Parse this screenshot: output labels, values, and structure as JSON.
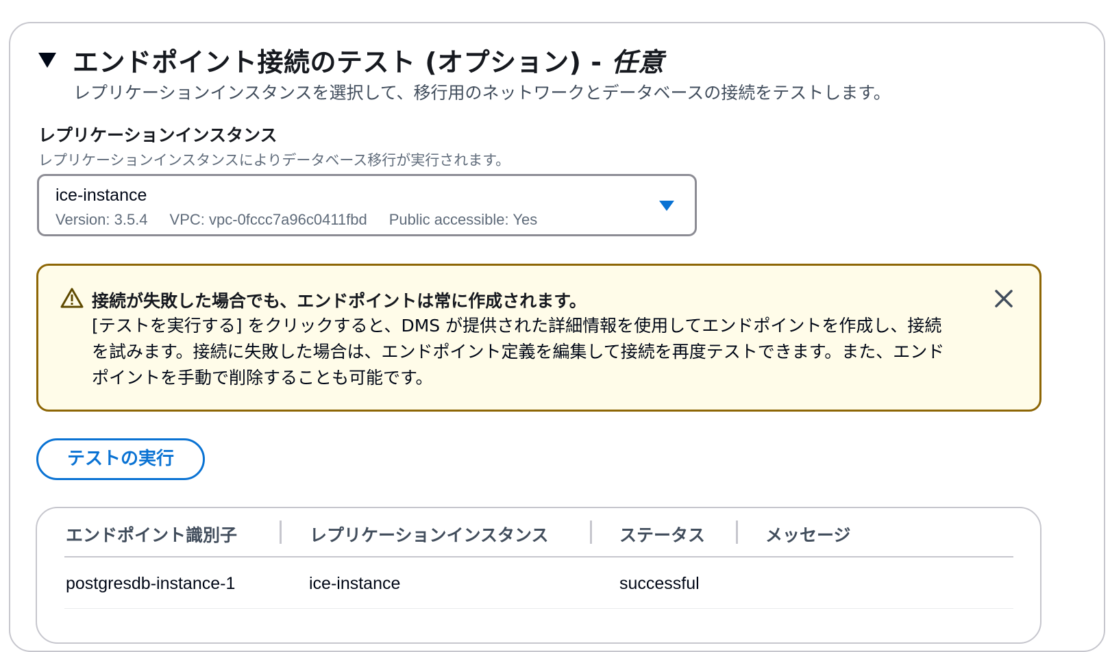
{
  "section": {
    "title": "エンドポイント接続のテスト (オプション) - ",
    "title_optional": "任意",
    "description": "レプリケーションインスタンスを選択して、移行用のネットワークとデータベースの接続をテストします。"
  },
  "replication_field": {
    "label": "レプリケーションインスタンス",
    "description": "レプリケーションインスタンスによりデータベース移行が実行されます。",
    "selected_value": "ice-instance",
    "version": "Version: 3.5.4",
    "vpc": "VPC: vpc-0fccc7a96c0411fbd",
    "public": "Public accessible: Yes"
  },
  "alert": {
    "type": "warning",
    "icon": "warning-icon",
    "title": "接続が失敗した場合でも、エンドポイントは常に作成されます。",
    "body": "[テストを実行する] をクリックすると、DMS が提供された詳細情報を使用してエンドポイントを作成し、接続を試みます。接続に失敗した場合は、エンドポイント定義を編集して接続を再度テストできます。また、エンドポイントを手動で削除することも可能です。"
  },
  "actions": {
    "run_test_label": "テストの実行"
  },
  "table": {
    "headers": [
      "エンドポイント識別子",
      "レプリケーションインスタンス",
      "ステータス",
      "メッセージ"
    ],
    "rows": [
      [
        "postgresdb-instance-1",
        "ice-instance",
        "successful",
        ""
      ]
    ]
  },
  "colors": {
    "accent": "#0972d3",
    "warning_border": "#8d6605",
    "warning_bg": "#fffce9",
    "border": "#c6c6cd"
  }
}
